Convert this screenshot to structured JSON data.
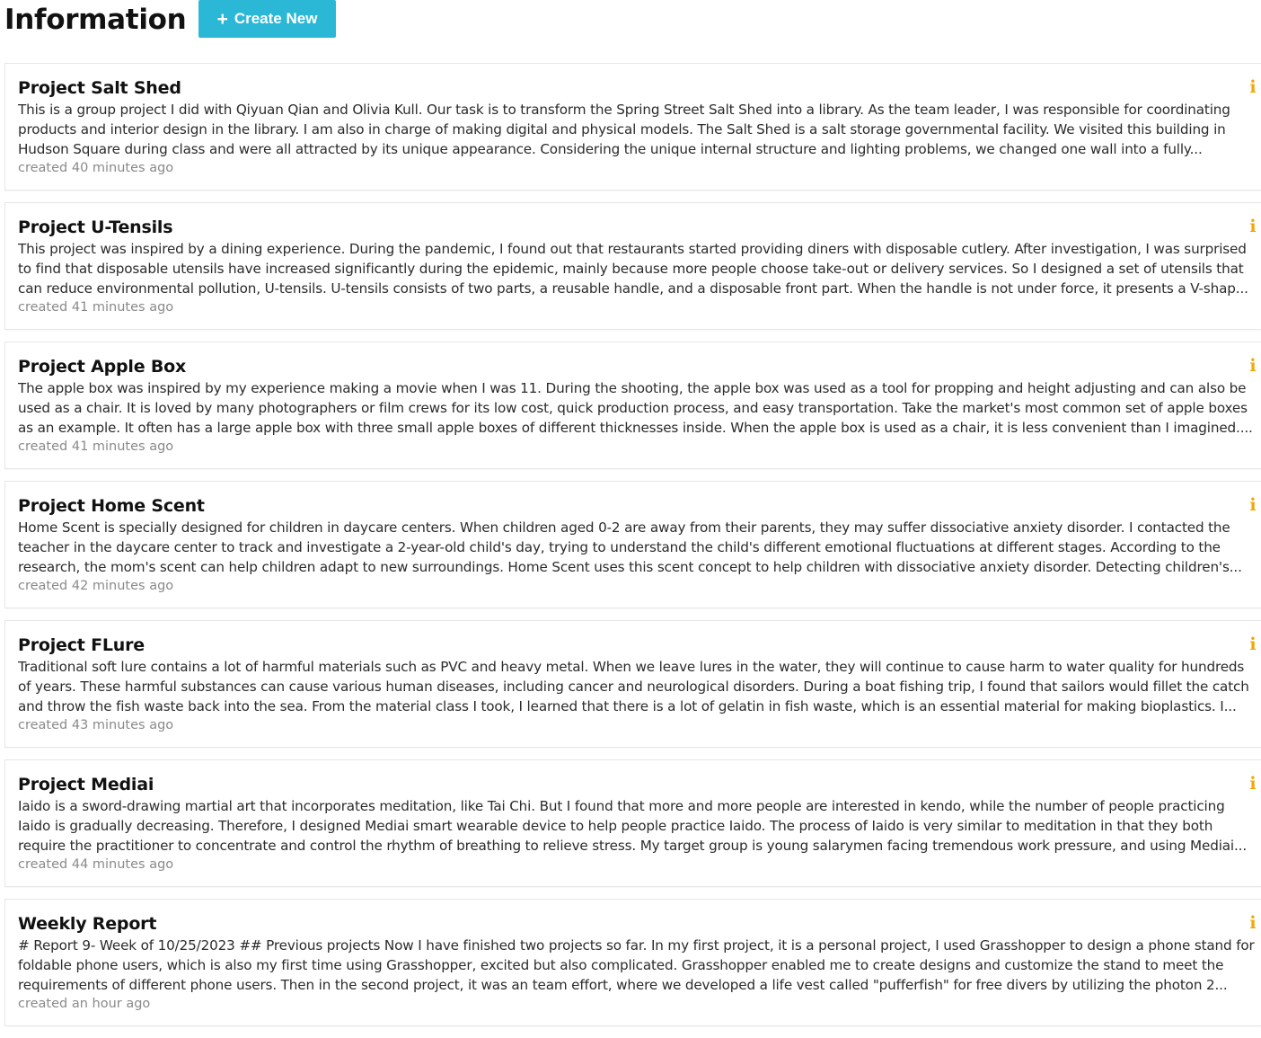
{
  "header": {
    "title": "Information",
    "create_button": {
      "label": "Create New",
      "icon": "plus-icon"
    }
  },
  "colors": {
    "accent": "#2bb8d6",
    "info_icon": "#f2a705",
    "muted_text": "#8a8a8a"
  },
  "cards": [
    {
      "title": "Project Salt Shed",
      "description": "This is a group project I did with Qiyuan Qian and Olivia Kull. Our task is to transform the Spring Street Salt Shed into a library. As the team leader, I was responsible for coordinating products and interior design in the library. I am also in charge of making digital and physical models. The Salt Shed is a salt storage governmental facility. We visited this building in Hudson Square during class and were all attracted by its unique appearance. Considering the unique internal structure and lighting problems, we changed one wall into a fully...",
      "created": "created 40 minutes ago",
      "icon": "info-icon"
    },
    {
      "title": "Project U-Tensils",
      "description": "This project was inspired by a dining experience. During the pandemic, I found out that restaurants started providing diners with disposable cutlery. After investigation, I was surprised to find that disposable utensils have increased significantly during the epidemic, mainly because more people choose take-out or delivery services. So I designed a set of utensils that can reduce environmental pollution, U-tensils. U-tensils consists of two parts, a reusable handle, and a disposable front part. When the handle is not under force, it presents a V-shap...",
      "created": "created 41 minutes ago",
      "icon": "info-icon"
    },
    {
      "title": "Project Apple Box",
      "description": "The apple box was inspired by my experience making a movie when I was 11. During the shooting, the apple box was used as a tool for propping and height adjusting and can also be used as a chair. It is loved by many photographers or film crews for its low cost, quick production process, and easy transportation. Take the market's most common set of apple boxes as an example. It often has a large apple box with three small apple boxes of different thicknesses inside. When the apple box is used as a chair, it is less convenient than I imagined....",
      "created": "created 41 minutes ago",
      "icon": "info-icon"
    },
    {
      "title": "Project Home Scent",
      "description": "Home Scent is specially designed for children in daycare centers. When children aged 0-2 are away from their parents, they may suffer dissociative anxiety disorder. I contacted the teacher in the daycare center to track and investigate a 2-year-old child's day, trying to understand the child's different emotional fluctuations at different stages. According to the research, the mom's scent can help children adapt to new surroundings. Home Scent uses this scent concept to help children with dissociative anxiety disorder. Detecting children's...",
      "created": "created 42 minutes ago",
      "icon": "info-icon"
    },
    {
      "title": "Project FLure",
      "description": "Traditional soft lure contains a lot of harmful materials such as PVC and heavy metal. When we leave lures in the water, they will continue to cause harm to water quality for hundreds of years. These harmful substances can cause various human diseases, including cancer and neurological disorders. During a boat fishing trip, I found that sailors would fillet the catch and throw the fish waste back into the sea. From the material class I took, I learned that there is a lot of gelatin in fish waste, which is an essential material for making bioplastics. I...",
      "created": "created 43 minutes ago",
      "icon": "info-icon"
    },
    {
      "title": "Project Mediai",
      "description": "Iaido is a sword-drawing martial art that incorporates meditation, like Tai Chi. But I found that more and more people are interested in kendo, while the number of people practicing Iaido is gradually decreasing. Therefore, I designed Mediai smart wearable device to help people practice Iaido. The process of Iaido is very similar to meditation in that they both require the practitioner to concentrate and control the rhythm of breathing to relieve stress. My target group is young salarymen facing tremendous work pressure, and using Mediai...",
      "created": "created 44 minutes ago",
      "icon": "info-icon"
    },
    {
      "title": "Weekly Report",
      "description": "# Report 9- Week of 10/25/2023 ## Previous projects Now I have finished two projects so far. In my first project, it is a personal project, I used Grasshopper to design a phone stand for foldable phone users, which is also my first time using Grasshopper, excited but also complicated. Grasshopper enabled me to create designs and customize the stand to meet the requirements of different phone users. Then in the second project, it was an team effort, where we developed a life vest called \"pufferfish\" for free divers by utilizing the photon 2...",
      "created": "created an hour ago",
      "icon": "info-icon"
    }
  ]
}
